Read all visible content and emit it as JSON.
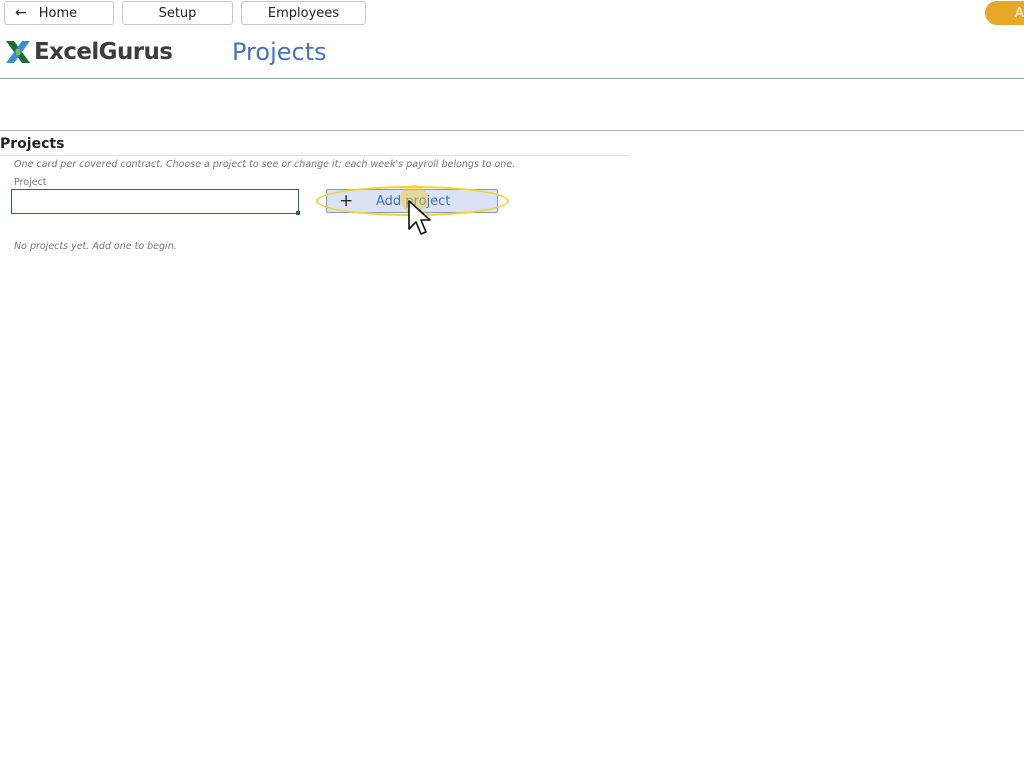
{
  "nav": {
    "home_label": "Home",
    "setup_label": "Setup",
    "employees_label": "Employees",
    "account_label": "A"
  },
  "brand": {
    "logo_text": "ExcelGurus"
  },
  "page": {
    "title": "Projects"
  },
  "projects": {
    "section_title": "Projects",
    "hint": "One card per covered contract. Choose a project to see or change it; each week's payroll belongs to one.",
    "field_label": "Project",
    "input_value": "",
    "add_button_label": "Add project",
    "empty_message": "No projects yet. Add one to begin."
  },
  "colors": {
    "accent_blue": "#4472c4",
    "excel_green": "#217346",
    "account_orange": "#e6a72a",
    "highlight_yellow": "#f2d434"
  },
  "icons": {
    "back": "arrow-left-icon",
    "add": "plus-icon",
    "logo": "excelgurus-x-logo",
    "cursor": "mouse-pointer-icon"
  }
}
